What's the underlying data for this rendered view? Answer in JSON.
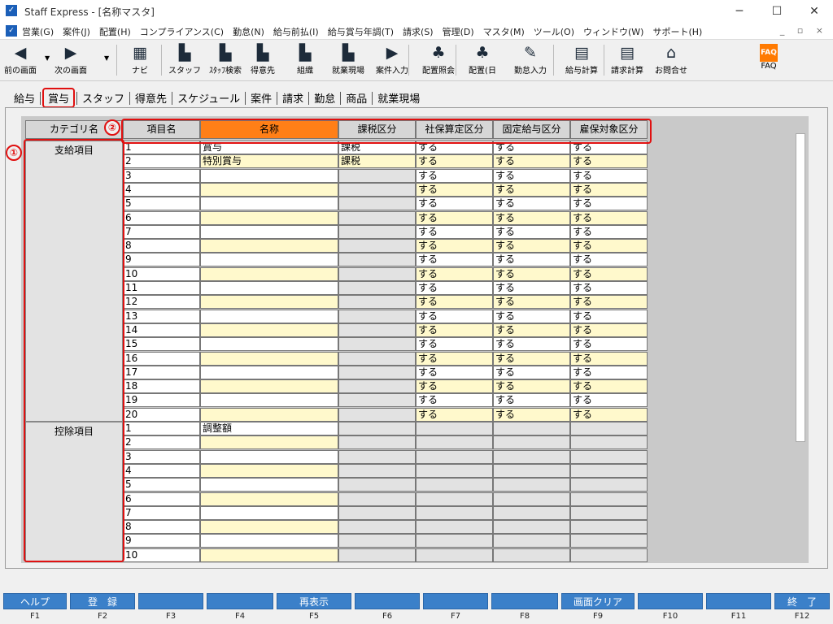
{
  "window": {
    "title": "Staff Express - [名称マスタ]",
    "app_icon": "app-icon",
    "min": "─",
    "max": "☐",
    "close": "✕"
  },
  "menu": {
    "items": [
      "営業(G)",
      "案件(J)",
      "配置(H)",
      "コンプライアンス(C)",
      "勤怠(N)",
      "給与前払(I)",
      "給与賞与年調(T)",
      "請求(S)",
      "管理(D)",
      "マスタ(M)",
      "ツール(O)",
      "ウィンドウ(W)",
      "サポート(H)"
    ],
    "mdi_controls": "_ ▫ ×"
  },
  "toolbar": [
    {
      "label": "前の画面",
      "icon": "back-arrow-icon",
      "glyph": "◀"
    },
    {
      "label": "次の画面",
      "icon": "forward-arrow-icon",
      "glyph": "▶"
    },
    {
      "label": "ナビ",
      "icon": "navi-icon",
      "glyph": "▦"
    },
    {
      "label": "スタッフ",
      "icon": "staff-icon",
      "glyph": "▙"
    },
    {
      "label": "ｽﾀｯﾌ検索",
      "icon": "staff-search-icon",
      "glyph": "▙"
    },
    {
      "label": "得意先",
      "icon": "client-icon",
      "glyph": "▙"
    },
    {
      "label": "組織",
      "icon": "organization-icon",
      "glyph": "▙"
    },
    {
      "label": "就業現場",
      "icon": "workplace-icon",
      "glyph": "▙"
    },
    {
      "label": "案件入力",
      "icon": "case-input-icon",
      "glyph": "▶"
    },
    {
      "label": "配置照会",
      "icon": "assignment-inquiry-icon",
      "glyph": "♣"
    },
    {
      "label": "配置(日",
      "icon": "assignment-daily-icon",
      "glyph": "♣"
    },
    {
      "label": "勤怠入力",
      "icon": "attendance-input-icon",
      "glyph": "✎"
    },
    {
      "label": "給与計算",
      "icon": "payroll-calc-icon",
      "glyph": "▤"
    },
    {
      "label": "請求計算",
      "icon": "billing-calc-icon",
      "glyph": "▤"
    },
    {
      "label": "お問合せ",
      "icon": "inquiry-icon",
      "glyph": "⌂"
    },
    {
      "label": "FAQ",
      "icon": "faq-icon",
      "glyph": "FAQ"
    }
  ],
  "tabs": [
    "給与",
    "賞与",
    "スタッフ",
    "得意先",
    "スケジュール",
    "案件",
    "請求",
    "勤怠",
    "商品",
    "就業現場"
  ],
  "active_tab": "賞与",
  "grid": {
    "headers": {
      "category": "カテゴリ名",
      "item": "項目名",
      "name": "名称",
      "tax": "課税区分",
      "social": "社保算定区分",
      "fixed": "固定給与区分",
      "employment": "雇保対象区分"
    },
    "sections": [
      {
        "category": "支給項目",
        "rows": [
          {
            "no": "1",
            "name": "賞与",
            "tax": "課税",
            "social": "する",
            "fixed": "する",
            "employment": "する"
          },
          {
            "no": "2",
            "name": "特別賞与",
            "tax": "課税",
            "social": "する",
            "fixed": "する",
            "employment": "する"
          },
          {
            "no": "3",
            "name": "",
            "tax": "",
            "social": "する",
            "fixed": "する",
            "employment": "する"
          },
          {
            "no": "4",
            "name": "",
            "tax": "",
            "social": "する",
            "fixed": "する",
            "employment": "する"
          },
          {
            "no": "5",
            "name": "",
            "tax": "",
            "social": "する",
            "fixed": "する",
            "employment": "する"
          },
          {
            "no": "6",
            "name": "",
            "tax": "",
            "social": "する",
            "fixed": "する",
            "employment": "する"
          },
          {
            "no": "7",
            "name": "",
            "tax": "",
            "social": "する",
            "fixed": "する",
            "employment": "する"
          },
          {
            "no": "8",
            "name": "",
            "tax": "",
            "social": "する",
            "fixed": "する",
            "employment": "する"
          },
          {
            "no": "9",
            "name": "",
            "tax": "",
            "social": "する",
            "fixed": "する",
            "employment": "する"
          },
          {
            "no": "10",
            "name": "",
            "tax": "",
            "social": "する",
            "fixed": "する",
            "employment": "する"
          },
          {
            "no": "11",
            "name": "",
            "tax": "",
            "social": "する",
            "fixed": "する",
            "employment": "する"
          },
          {
            "no": "12",
            "name": "",
            "tax": "",
            "social": "する",
            "fixed": "する",
            "employment": "する"
          },
          {
            "no": "13",
            "name": "",
            "tax": "",
            "social": "する",
            "fixed": "する",
            "employment": "する"
          },
          {
            "no": "14",
            "name": "",
            "tax": "",
            "social": "する",
            "fixed": "する",
            "employment": "する"
          },
          {
            "no": "15",
            "name": "",
            "tax": "",
            "social": "する",
            "fixed": "する",
            "employment": "する"
          },
          {
            "no": "16",
            "name": "",
            "tax": "",
            "social": "する",
            "fixed": "する",
            "employment": "する"
          },
          {
            "no": "17",
            "name": "",
            "tax": "",
            "social": "する",
            "fixed": "する",
            "employment": "する"
          },
          {
            "no": "18",
            "name": "",
            "tax": "",
            "social": "する",
            "fixed": "する",
            "employment": "する"
          },
          {
            "no": "19",
            "name": "",
            "tax": "",
            "social": "する",
            "fixed": "する",
            "employment": "する"
          },
          {
            "no": "20",
            "name": "",
            "tax": "",
            "social": "する",
            "fixed": "する",
            "employment": "する"
          }
        ]
      },
      {
        "category": "控除項目",
        "rows": [
          {
            "no": "1",
            "name": "調整額",
            "tax": "",
            "social": "",
            "fixed": "",
            "employment": ""
          },
          {
            "no": "2",
            "name": "",
            "tax": "",
            "social": "",
            "fixed": "",
            "employment": ""
          },
          {
            "no": "3",
            "name": "",
            "tax": "",
            "social": "",
            "fixed": "",
            "employment": ""
          },
          {
            "no": "4",
            "name": "",
            "tax": "",
            "social": "",
            "fixed": "",
            "employment": ""
          },
          {
            "no": "5",
            "name": "",
            "tax": "",
            "social": "",
            "fixed": "",
            "employment": ""
          },
          {
            "no": "6",
            "name": "",
            "tax": "",
            "social": "",
            "fixed": "",
            "employment": ""
          },
          {
            "no": "7",
            "name": "",
            "tax": "",
            "social": "",
            "fixed": "",
            "employment": ""
          },
          {
            "no": "8",
            "name": "",
            "tax": "",
            "social": "",
            "fixed": "",
            "employment": ""
          },
          {
            "no": "9",
            "name": "",
            "tax": "",
            "social": "",
            "fixed": "",
            "employment": ""
          },
          {
            "no": "10",
            "name": "",
            "tax": "",
            "social": "",
            "fixed": "",
            "employment": ""
          }
        ]
      }
    ]
  },
  "callouts": {
    "one": "①",
    "two": "②"
  },
  "fkeys": [
    {
      "key": "F1",
      "label": "ヘルプ"
    },
    {
      "key": "F2",
      "label": "登　録"
    },
    {
      "key": "F3",
      "label": ""
    },
    {
      "key": "F4",
      "label": ""
    },
    {
      "key": "F5",
      "label": "再表示"
    },
    {
      "key": "F6",
      "label": ""
    },
    {
      "key": "F7",
      "label": ""
    },
    {
      "key": "F8",
      "label": ""
    },
    {
      "key": "F9",
      "label": "画面クリア"
    },
    {
      "key": "F10",
      "label": ""
    },
    {
      "key": "F11",
      "label": ""
    },
    {
      "key": "F12",
      "label": "終　了"
    }
  ],
  "colors": {
    "accent_header": "#ff7f17",
    "highlight": "#e01010",
    "fkey": "#3b80c9",
    "row_yellow": "#fff9cc"
  }
}
